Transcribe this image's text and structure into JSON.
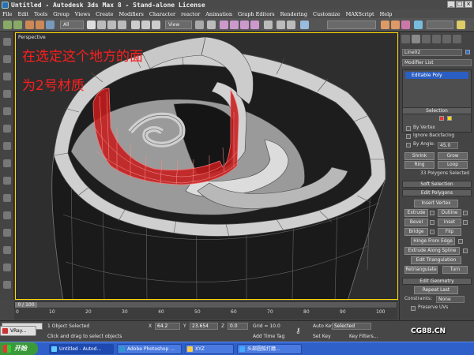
{
  "title_bar": {
    "title": "Untitled - Autodesk 3ds Max 8 - Stand-alone License",
    "window_buttons": [
      "minimize-icon",
      "maximize-icon",
      "close-icon"
    ]
  },
  "menu": [
    "File",
    "Edit",
    "Tools",
    "Group",
    "Views",
    "Create",
    "Modifiers",
    "Character",
    "reactor",
    "Animation",
    "Graph Editors",
    "Rendering",
    "Customize",
    "MAXScript",
    "Help"
  ],
  "toolbar": {
    "selection_filter": "All",
    "reference_coord": "View"
  },
  "viewport": {
    "label": "Perspective",
    "annotation_line1": "在选定这个地方的面",
    "annotation_line2": "为2号材质",
    "colors": {
      "border": "#ffd800",
      "selection": "#d21e1e",
      "mesh": "#d8d8d8",
      "edge": "#555555",
      "background": "#2e2e2e"
    }
  },
  "command_panel": {
    "object_name": "Line02",
    "modifier_list": "Modifier List",
    "stack_item": "Editable Poly",
    "selection_rollout": "Selection",
    "by_vertex": "By Vertex",
    "ignore_backfacing": "Ignore Backfacing",
    "by_angle": "By Angle:",
    "by_angle_value": "45.0",
    "shrink": "Shrink",
    "grow": "Grow",
    "ring": "Ring",
    "loop": "Loop",
    "selected_info": "33 Polygons Selected",
    "soft_selection": "Soft Selection",
    "edit_polygons": "Edit Polygons",
    "insert_vertex": "Insert Vertex",
    "extrude": "Extrude",
    "outline": "Outline",
    "bevel": "Bevel",
    "inset": "Inset",
    "bridge": "Bridge",
    "flip": "Flip",
    "hinge_from_edge": "Hinge From Edge",
    "extrude_along_spline": "Extrude Along Spline",
    "edit_triangulation": "Edit Triangulation",
    "retriangulate": "Retriangulate",
    "turn": "Turn",
    "edit_geometry": "Edit Geometry",
    "repeat_last": "Repeat Last",
    "constraints": "Constraints:",
    "constraints_value": "None",
    "preserve_uvs": "Preserve UVs"
  },
  "timeline": {
    "frame": "0 / 100",
    "ticks": [
      "0",
      "10",
      "20",
      "30",
      "40",
      "50",
      "60",
      "70",
      "80",
      "90",
      "100"
    ]
  },
  "status": {
    "objects_selected": "1 Object Selected",
    "prompt": "Click and drag to select objects",
    "x_label": "X",
    "x_value": "64.2",
    "y_label": "Y",
    "y_value": "23.654",
    "z_label": "Z",
    "z_value": "0.0",
    "grid": "Grid = 10.0",
    "add_time_tag": "Add Time Tag",
    "auto_key": "Auto Key",
    "set_key": "Set Key",
    "key_mode": "Selected",
    "key_filters": "Key Filters..."
  },
  "taskbar": {
    "start": "开始",
    "items": [
      "Untitled - Autod...",
      "Adobe Photoshop ...",
      "XYZ",
      "头部圆弧打磨..."
    ],
    "partial_item": "VRay...",
    "watermark": "CG88.CN"
  }
}
